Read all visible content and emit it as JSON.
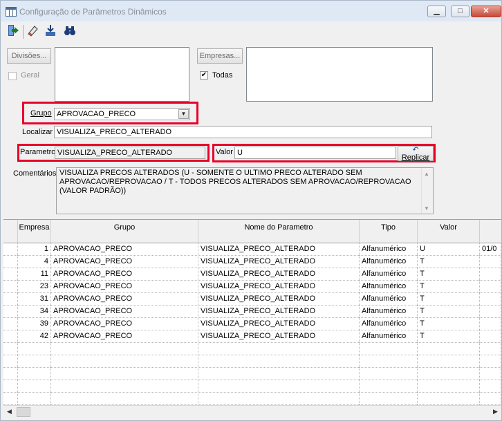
{
  "window": {
    "title": "Configuração de Parâmetros Dinâmicos",
    "minimize": "▁",
    "maximize": "□",
    "close": "✕"
  },
  "toolbar": {
    "icons": [
      "exit-icon",
      "eraser-icon",
      "save-icon",
      "binoculars-icon"
    ]
  },
  "divisoes": {
    "button_label": "Divisões...",
    "geral_label": "Geral",
    "geral_checked": false
  },
  "empresas": {
    "button_label": "Empresas...",
    "todas_label": "Todas",
    "todas_checked": true,
    "check_mark": "✔"
  },
  "grupo": {
    "label": "Grupo",
    "value": "APROVACAO_PRECO",
    "arrow": "▼"
  },
  "localizar": {
    "label": "Localizar",
    "value": "VISUALIZA_PRECO_ALTERADO"
  },
  "parametro": {
    "label": "Parametro",
    "value": "VISUALIZA_PRECO_ALTERADO"
  },
  "valor": {
    "label": "Valor",
    "value": "U"
  },
  "replicar": {
    "label": "Replicar",
    "icon": "↶"
  },
  "comentarios": {
    "label": "Comentários",
    "text": "VISUALIZA PRECOS ALTERADOS (U - SOMENTE O ULTIMO PRECO ALTERADO SEM APROVACAO/REPROVACAO / T - TODOS PRECOS ALTERADOS SEM APROVACAO/REPROVACAO (VALOR PADRÃO))"
  },
  "grid": {
    "columns": [
      "Empresa",
      "Grupo",
      "Nome do Parametro",
      "Tipo",
      "Valor",
      ""
    ],
    "rows": [
      [
        "1",
        "APROVACAO_PRECO",
        "VISUALIZA_PRECO_ALTERADO",
        "Alfanumérico",
        "U",
        "01/0"
      ],
      [
        "4",
        "APROVACAO_PRECO",
        "VISUALIZA_PRECO_ALTERADO",
        "Alfanumérico",
        "T",
        ""
      ],
      [
        "11",
        "APROVACAO_PRECO",
        "VISUALIZA_PRECO_ALTERADO",
        "Alfanumérico",
        "T",
        ""
      ],
      [
        "23",
        "APROVACAO_PRECO",
        "VISUALIZA_PRECO_ALTERADO",
        "Alfanumérico",
        "T",
        ""
      ],
      [
        "31",
        "APROVACAO_PRECO",
        "VISUALIZA_PRECO_ALTERADO",
        "Alfanumérico",
        "T",
        ""
      ],
      [
        "34",
        "APROVACAO_PRECO",
        "VISUALIZA_PRECO_ALTERADO",
        "Alfanumérico",
        "T",
        ""
      ],
      [
        "39",
        "APROVACAO_PRECO",
        "VISUALIZA_PRECO_ALTERADO",
        "Alfanumérico",
        "T",
        ""
      ],
      [
        "42",
        "APROVACAO_PRECO",
        "VISUALIZA_PRECO_ALTERADO",
        "Alfanumérico",
        "T",
        ""
      ]
    ],
    "empty_rows": 6
  },
  "scroll": {
    "left_arrow": "◀",
    "right_arrow": "▶",
    "up_arrow": "▲",
    "down_arrow": "▼"
  }
}
